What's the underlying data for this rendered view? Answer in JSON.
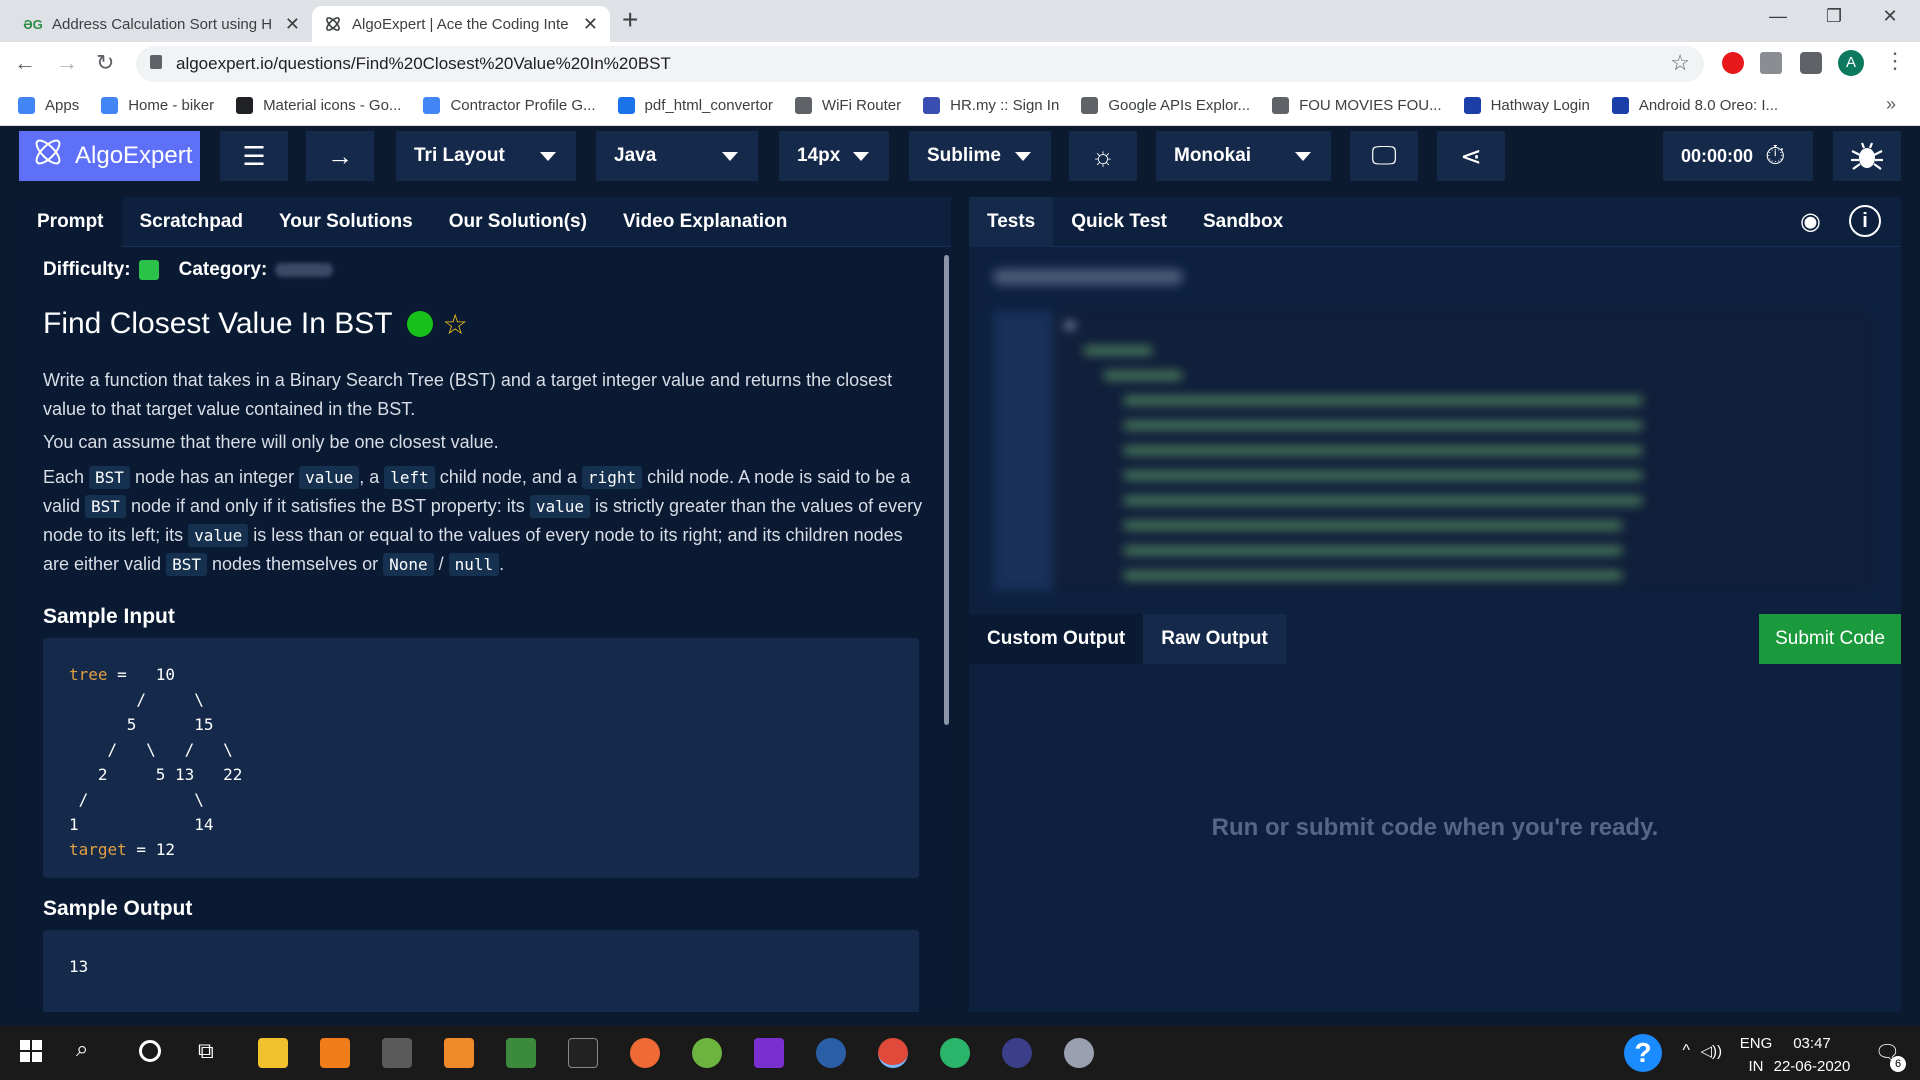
{
  "browser": {
    "tabs": [
      {
        "title": "Address Calculation Sort using H",
        "favicon": "gfg-icon"
      },
      {
        "title": "AlgoExpert | Ace the Coding Inte",
        "favicon": "algoexpert-icon"
      }
    ],
    "url": "algoexpert.io/questions/Find%20Closest%20Value%20In%20BST",
    "profile_initial": "A",
    "bookmarks": [
      {
        "label": "Apps",
        "icon": "apps-grid-icon",
        "color": "#4285f4"
      },
      {
        "label": "Home - biker",
        "icon": "google-icon",
        "color": "#4285f4"
      },
      {
        "label": "Material icons - Go...",
        "icon": "material-icon",
        "color": "#202124"
      },
      {
        "label": "Contractor Profile G...",
        "icon": "docs-icon",
        "color": "#4285f4"
      },
      {
        "label": "pdf_html_convertor",
        "icon": "bookmark-icon",
        "color": "#1a73e8"
      },
      {
        "label": "WiFi Router",
        "icon": "globe-icon",
        "color": "#5f6368"
      },
      {
        "label": "HR.my :: Sign In",
        "icon": "hr-icon",
        "color": "#3a4db0"
      },
      {
        "label": "Google APIs Explor...",
        "icon": "globe-icon",
        "color": "#5f6368"
      },
      {
        "label": "FOU MOVIES FOU...",
        "icon": "globe-icon",
        "color": "#5f6368"
      },
      {
        "label": "Hathway Login",
        "icon": "hathway-icon",
        "color": "#1a3fa8"
      },
      {
        "label": "Android 8.0 Oreo: I...",
        "icon": "android-icon",
        "color": "#1a3fa8"
      }
    ]
  },
  "toolbar": {
    "logo": "AlgoExpert",
    "layout": "Tri Layout",
    "language": "Java",
    "font_size": "14px",
    "keymap": "Sublime",
    "theme": "Monokai",
    "timer": "00:00:00"
  },
  "left_tabs": [
    "Prompt",
    "Scratchpad",
    "Your Solutions",
    "Our Solution(s)",
    "Video Explanation"
  ],
  "question": {
    "difficulty_label": "Difficulty:",
    "category_label": "Category:",
    "title": "Find Closest Value In BST",
    "p1": "Write a function that takes in a Binary Search Tree (BST) and a target integer value and returns the closest value to that target value contained in the BST.",
    "p2": "You can assume that there will only be one closest value.",
    "p3": {
      "t1": "Each ",
      "c1": "BST",
      "t2": " node has an integer ",
      "c2": "value",
      "t3": ", a ",
      "c3": "left",
      "t4": " child node, and a ",
      "c4": "right",
      "t5": " child node. A node is said to be a valid ",
      "c5": "BST",
      "t6": " node if and only if it satisfies the BST property: its ",
      "c6": "value",
      "t7": " is strictly greater than the values of every node to its left; its ",
      "c7": "value",
      "t8": " is less than or equal to the values of every node to its right; and its children nodes are either valid ",
      "c8": "BST",
      "t9": " nodes themselves or ",
      "c9": "None",
      "t10": " / ",
      "c10": "null",
      "t11": "."
    },
    "sample_input_heading": "Sample Input",
    "sample_input": {
      "kw_tree": "tree",
      "tree_rest": " =   10\n       /     \\\n      5      15\n    /   \\   /   \\\n   2     5 13   22\n /           \\\n1            14\n",
      "kw_target": "target",
      "target_rest": " = 12"
    },
    "sample_output_heading": "Sample Output",
    "sample_output": "13"
  },
  "right_tabs": [
    "Tests",
    "Quick Test",
    "Sandbox"
  ],
  "output_tabs": [
    "Custom Output",
    "Raw Output"
  ],
  "submit_label": "Submit Code",
  "run_message": "Run or submit code when you're ready.",
  "taskbar": {
    "lang_top": "ENG",
    "lang_bottom": "IN",
    "time": "03:47",
    "date": "22-06-2020",
    "notification_count": "6"
  }
}
